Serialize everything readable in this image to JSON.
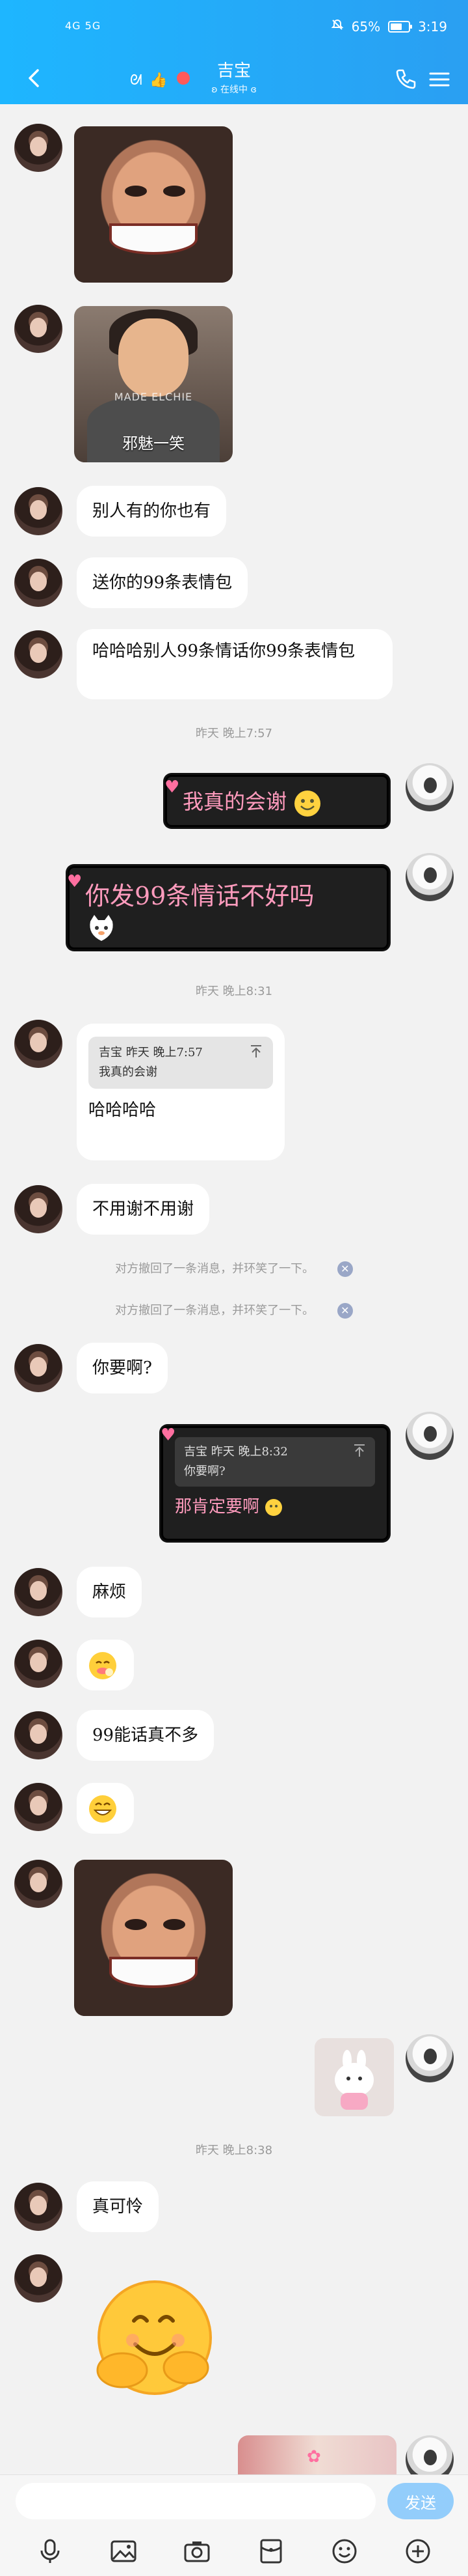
{
  "status_bar": {
    "carrier": "4G 5G",
    "battery": "65%",
    "battery_level": 0.65,
    "time": "3:19"
  },
  "header": {
    "title": "吉宝",
    "subtitle": "ʚ 在线中 ɞ"
  },
  "messages": [
    {
      "from": "them",
      "type": "image",
      "image_desc_icon": "photo-man-smile"
    },
    {
      "from": "them",
      "type": "image",
      "caption": "邪魅一笑",
      "watermark": "MADE ELCHIE"
    },
    {
      "from": "them",
      "type": "text",
      "text": "别人有的你也有"
    },
    {
      "from": "them",
      "type": "text",
      "text": "送你的99条表情包"
    },
    {
      "from": "them",
      "type": "text",
      "text": "哈哈哈别人99条情话你99条表情包"
    },
    {
      "from": "me",
      "type": "styled",
      "text": "我真的会谢"
    },
    {
      "from": "me",
      "type": "styled",
      "text": "你发99条情话不好吗"
    },
    {
      "from": "them",
      "type": "quote",
      "quote_author": "吉宝",
      "quote_date": "昨天 晚上7:57",
      "quote_text": "我真的会谢",
      "text": "哈哈哈哈"
    },
    {
      "from": "them",
      "type": "text",
      "text": "不用谢不用谢"
    },
    {
      "from": "them",
      "type": "text",
      "text": "你要啊?"
    },
    {
      "from": "me",
      "type": "quote-styled",
      "quote_author": "吉宝",
      "quote_date": "昨天 晚上8:32",
      "quote_text": "你要啊?",
      "text": "那肯定要啊"
    },
    {
      "from": "them",
      "type": "text",
      "text": "麻烦"
    },
    {
      "from": "them",
      "type": "text",
      "text": "99能话真不多"
    }
  ],
  "timestamps": {
    "t1": "昨天 晚上7:57",
    "t2": "昨天 晚上8:31",
    "t3": "昨天 晚上8:38"
  },
  "system_notes": {
    "recall1": "对方撤回了一条消息，并环笑了一下。",
    "recall2": "对方撤回了一条消息，并环笑了一下。"
  },
  "after": {
    "text1": "真可怜"
  },
  "input": {
    "placeholder": "",
    "send_label": "发送"
  },
  "colors": {
    "header": "#1eb6ff",
    "dark_bubble_text": "#ff9bbd",
    "send_button": "#93cdfb"
  }
}
